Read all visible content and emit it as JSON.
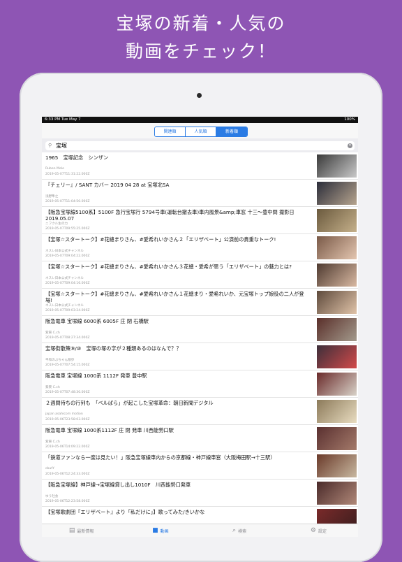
{
  "headline": {
    "line1": "宝塚の新着・人気の",
    "line2": "動画をチェック！"
  },
  "status": {
    "time": "6:33 PM   Tue May 7",
    "battery": "100%"
  },
  "segments": [
    {
      "label": "関連順",
      "active": false
    },
    {
      "label": "人気順",
      "active": false
    },
    {
      "label": "新着順",
      "active": true
    }
  ],
  "search": {
    "query": "宝塚",
    "icon": "search-icon"
  },
  "videos": [
    {
      "title": "1965　宝塚記念　シンザン",
      "channel": "Ruben Mele",
      "date": "2019-05-07T11:31:22.000Z",
      "thumb": [
        "#3a3a3a",
        "#c9c9c9"
      ]
    },
    {
      "title": "『チェリー』/ SANT カバー 2019 04 28 at 宝塚北SA",
      "channel": "浅野隼之",
      "date": "2019-05-07T11:04:50.000Z",
      "thumb": [
        "#2b2d3a",
        "#b6a48e"
      ]
    },
    {
      "title": "【阪急宝塚線5100系】5100F 急行宝塚行 5794号車(運転台撤去車)車内風景&amp;車窓 十三～豊中間 撮影日2019.05.07",
      "channel": "ニフクル生の力",
      "date": "2019-05-07T09:55:25.000Z",
      "thumb": [
        "#6b5a3e",
        "#c5b08a"
      ]
    },
    {
      "title": "【宝塚☆スタートーク】#花總まりさん、#愛希れいかさん２「エリザベート」公演前の貴重なトーク!",
      "channel": "ネスレ日本公式チャンネル",
      "date": "2019-05-07T09:04:22.000Z",
      "thumb": [
        "#7a5a48",
        "#e4c6b0"
      ]
    },
    {
      "title": "【宝塚☆スタートーク】#花總まりさん、#愛希れいかさん３花總・愛希が思う「エリザベート」の魅力とは?",
      "channel": "ネスレ日本公式チャンネル",
      "date": "2019-05-07T09:04:16.000Z",
      "thumb": [
        "#4e3a30",
        "#d9b9a2"
      ]
    },
    {
      "title": "【宝塚☆スタートーク】#花總まりさん、#愛希れいかさん１花總まり・愛希れいか、元宝塚トップ娘役の二人が登場!",
      "channel": "ネスレ日本公式チャンネル",
      "date": "2019-05-07T09:03:24.000Z",
      "thumb": [
        "#5e4a3c",
        "#e0c3a8"
      ]
    },
    {
      "title": "阪急電車 宝塚線 6000系 6005F 庄 閉 石橋駅",
      "channel": "紫東 C.ch",
      "date": "2019-05-07T08:27:34.000Z",
      "thumb": [
        "#5a2f2a",
        "#a39a8c"
      ]
    },
    {
      "title": "宝塚街散策⑨/⑩　宝塚の塚の字が２種類あるのはなんで？？",
      "channel": "平和のぶちゃん散歩",
      "date": "2019-05-07T07:54:15.000Z",
      "thumb": [
        "#3d2f3a",
        "#d24a4a"
      ]
    },
    {
      "title": "阪急電車 宝塚線 1000系 1112F 発車 豊中駅",
      "channel": "紫東 C.ch",
      "date": "2019-05-07T07:48:30.000Z",
      "thumb": [
        "#6a2a2a",
        "#d8d2c8"
      ]
    },
    {
      "title": "２週間待ちの行列も　「ベルばら」が起こした宝塚革命：朝日新聞デジタル",
      "channel": "japan asahicom motion",
      "date": "2019-05-06T23:58:03.000Z",
      "thumb": [
        "#8c7a5a",
        "#e8dcc0"
      ]
    },
    {
      "title": "阪急電車 宝塚線 1000系1112F 庄 閉 発車 川西能勢口駅",
      "channel": "紫東 C.ch",
      "date": "2019-05-06T14:09:22.000Z",
      "thumb": [
        "#5a3030",
        "#a47a6a"
      ]
    },
    {
      "title": "「鉄道ファンなら一度は見たい！」阪急宝塚線車内からの京都線・神戸線車窓（大阪梅田駅→十三駅）",
      "channel": "cbutY",
      "date": "2019-05-06T12:24:33.000Z",
      "thumb": [
        "#6a3a2a",
        "#c8b8a0"
      ]
    },
    {
      "title": "【阪急宝塚線】神戸線→宝塚線貸し出し1010F　川西能勢口発車",
      "channel": "ゆう社会",
      "date": "2019-05-06T12:23:58.000Z",
      "thumb": [
        "#4a2a2a",
        "#b08878"
      ]
    },
    {
      "title": "【宝塚歌劇団『エリザベート』より「私だけに」】歌ってみた/きいかな",
      "channel": "",
      "date": "",
      "thumb": [
        "#7a2a2a",
        "#3a1e1e"
      ]
    }
  ],
  "tabs": [
    {
      "label": "最新情報",
      "icon": "news-icon",
      "glyph": "▤",
      "active": false
    },
    {
      "label": "動画",
      "icon": "video-icon",
      "glyph": "■",
      "active": true
    },
    {
      "label": "検索",
      "icon": "search-icon",
      "glyph": "⌕",
      "active": false
    },
    {
      "label": "設定",
      "icon": "gear-icon",
      "glyph": "⚙",
      "active": false
    }
  ]
}
